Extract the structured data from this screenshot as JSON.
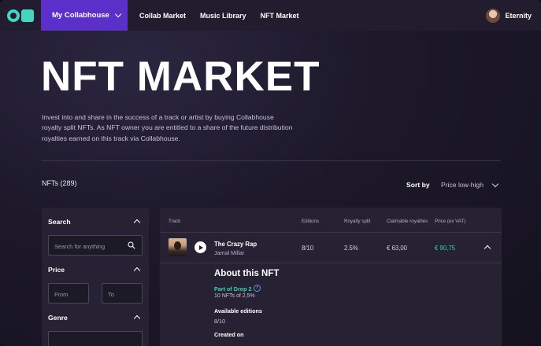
{
  "nav": {
    "collab_label": "My Collabhouse",
    "links": [
      "Collab Market",
      "Music Library",
      "NFT Market"
    ],
    "user_name": "Eternity",
    "brand_color": "#5b2fc9",
    "logo_color": "#44d6c0"
  },
  "hero": {
    "title": "NFT MARKET",
    "description": "Invest into and share in the success of a track or artist by buying Collabhouse royalty split NFTs. As NFT owner you are entitled to a share of the future distribution royalties earned on this track via Collabhouse."
  },
  "listing": {
    "count_label": "NFTs (289)",
    "sort_label": "Sort by",
    "sort_value": "Price low-high"
  },
  "filters": {
    "search_label": "Search",
    "search_placeholder": "Search for anything",
    "price_label": "Price",
    "from_placeholder": "From",
    "to_placeholder": "To",
    "genre_label": "Genre"
  },
  "table": {
    "headers": [
      "Track",
      "Editions",
      "Royalty split",
      "Claimable royalties",
      "Price (ex VAT)"
    ],
    "rows": [
      {
        "title": "The Crazy Rap",
        "artist": "Jamal Millar",
        "editions": "8/10",
        "royalty_split": "2.5%",
        "claimable": "€ 63,00",
        "price": "€ 90,75"
      }
    ],
    "price_color": "#37d3ad"
  },
  "about": {
    "title": "About this NFT",
    "drop_label": "Part of Drop 2",
    "drop_sub": "10 NFTs of 2,5%",
    "editions_label": "Available editions",
    "editions_value": "8/10",
    "created_label": "Created on"
  }
}
